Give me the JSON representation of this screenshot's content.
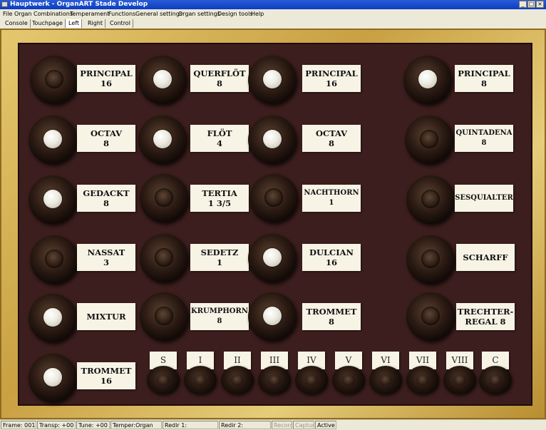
{
  "window": {
    "title": "Hauptwerk - OrganART Stade Develop"
  },
  "menu": [
    "File",
    "Organ",
    "Combinations",
    "Temperament",
    "Functions",
    "General settings",
    "Organ settings",
    "Design tools",
    "Help"
  ],
  "tabs": [
    "Console",
    "Touchpage",
    "Left",
    "Right",
    "Control"
  ],
  "active_tab": "Left",
  "stops": [
    {
      "l1": "PRINCIPAL",
      "l2": "16",
      "on": false
    },
    {
      "l1": "OCTAV",
      "l2": "8",
      "on": true
    },
    {
      "l1": "GEDACKT",
      "l2": "8",
      "on": true
    },
    {
      "l1": "NASSAT",
      "l2": "3",
      "on": false
    },
    {
      "l1": "MIXTUR",
      "l2": "",
      "on": true
    },
    {
      "l1": "TROMMET",
      "l2": "16",
      "on": true
    },
    {
      "l1": "QUERFLÖT",
      "l2": "8",
      "on": true
    },
    {
      "l1": "FLÖT",
      "l2": "4",
      "on": true
    },
    {
      "l1": "TERTIA",
      "l2": "1 3/5",
      "on": false
    },
    {
      "l1": "SEDETZ",
      "l2": "1",
      "on": false
    },
    {
      "l1": "KRUMPHORN",
      "l2": "8",
      "on": false
    },
    {
      "l1": "PRINCIPAL",
      "l2": "16",
      "on": true
    },
    {
      "l1": "OCTAV",
      "l2": "8",
      "on": true
    },
    {
      "l1": "NACHTHORN",
      "l2": "1",
      "on": false
    },
    {
      "l1": "DULCIAN",
      "l2": "16",
      "on": true
    },
    {
      "l1": "TROMMET",
      "l2": "8",
      "on": true
    },
    {
      "l1": "PRINCIPAL",
      "l2": "8",
      "on": true
    },
    {
      "l1": "QUINTADENA",
      "l2": "8",
      "on": false
    },
    {
      "l1": "SESQUIALTER",
      "l2": "",
      "on": false
    },
    {
      "l1": "SCHARFF",
      "l2": "",
      "on": false
    },
    {
      "l1": "TRECHTER-",
      "l2": "REGAL 8",
      "on": false
    }
  ],
  "combinations": [
    "S",
    "I",
    "II",
    "III",
    "IV",
    "V",
    "VI",
    "VII",
    "VIII",
    "C"
  ],
  "status": {
    "frame": "Frame: 001",
    "transp": "Transp: +00",
    "tune": "Tune: +00",
    "temper": "Temper:Organ",
    "redir1": "Redir 1:",
    "redir2": "Redir 2:",
    "record": "Record",
    "capture": "Capture",
    "active": "Active"
  }
}
